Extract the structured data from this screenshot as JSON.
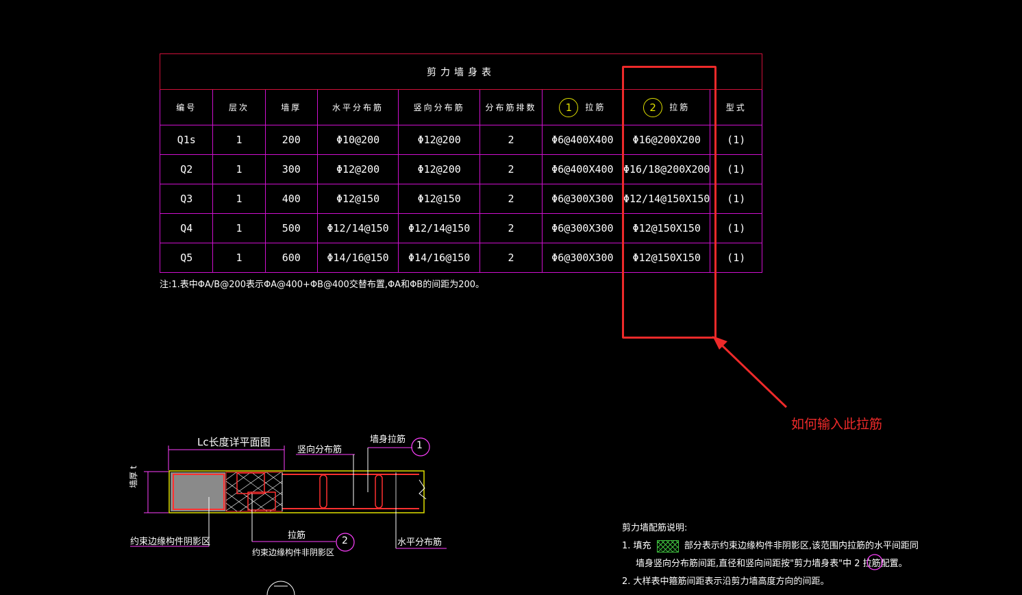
{
  "table": {
    "title": "剪力墙身表",
    "headers": [
      "编号",
      "层次",
      "墙厚",
      "水平分布筋",
      "竖向分布筋",
      "分布筋排数",
      "拉筋",
      "拉筋"
    ],
    "header_circles": {
      "col7": "1",
      "col8": "2"
    },
    "type_header": "型式",
    "rows": [
      [
        "Q1s",
        "1",
        "200",
        "Φ10@200",
        "Φ12@200",
        "2",
        "Φ6@400X400",
        "Φ16@200X200",
        "(1)"
      ],
      [
        "Q2",
        "1",
        "300",
        "Φ12@200",
        "Φ12@200",
        "2",
        "Φ6@400X400",
        "Φ16/18@200X200",
        "(1)"
      ],
      [
        "Q3",
        "1",
        "400",
        "Φ12@150",
        "Φ12@150",
        "2",
        "Φ6@300X300",
        "Φ12/14@150X150",
        "(1)"
      ],
      [
        "Q4",
        "1",
        "500",
        "Φ12/14@150",
        "Φ12/14@150",
        "2",
        "Φ6@300X300",
        "Φ12@150X150",
        "(1)"
      ],
      [
        "Q5",
        "1",
        "600",
        "Φ14/16@150",
        "Φ14/16@150",
        "2",
        "Φ6@300X300",
        "Φ12@150X150",
        "(1)"
      ]
    ]
  },
  "note": "注:1.表中ΦA/B@200表示ΦA@400+ΦB@400交替布置,ΦA和ΦB的间距为200。",
  "annotation": "如何输入此拉筋",
  "colors": {
    "highlight": "#ee2a2a",
    "grid": "#d010d0",
    "circle": "#e0e000"
  },
  "detail": {
    "lc_label": "Lc长度详平面图",
    "vertical_bar": "竖向分布筋",
    "wall_tie": "墙身拉筋",
    "circle1": "1",
    "thickness": "墙厚 t",
    "shadow_zone": "约束边缘构件阴影区",
    "tie": "拉筋",
    "non_shadow_zone": "约束边缘构件非阴影区",
    "circle2": "2",
    "horizontal_bar": "水平分布筋"
  },
  "legend": {
    "title": "剪力墙配筋说明:",
    "line1_prefix": "1. 填充",
    "line1_text": "部分表示约束边缘构件非阴影区,该范围内拉筋的水平间距同",
    "line2": "墙身竖向分布筋间距,直径和竖向间距按\"剪力墙身表\"中 2  拉筋配置。",
    "line3": "2. 大样表中箍筋间距表示沿剪力墙高度方向的间距。"
  }
}
